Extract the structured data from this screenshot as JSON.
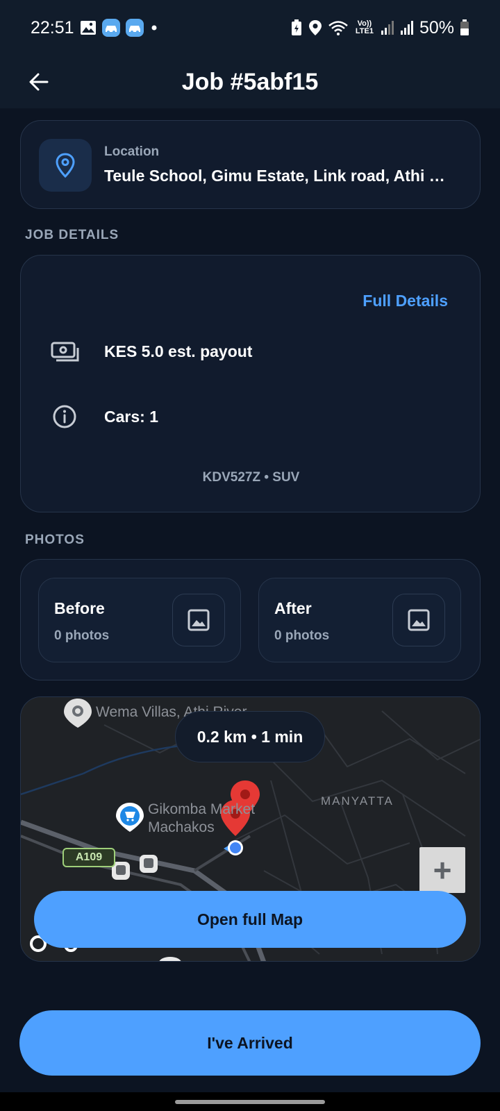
{
  "status_bar": {
    "time": "22:51",
    "battery": "50%",
    "network_label": "Vo)) LTE1",
    "icons": [
      "gallery-icon",
      "car-wash-app-icon",
      "car-wash-app-icon",
      "dot-icon",
      "battery-saver-icon",
      "location-icon",
      "wifi-icon",
      "signal-icon",
      "signal-icon",
      "battery-icon"
    ]
  },
  "appbar": {
    "title": "Job #5abf15",
    "back_icon": "arrow-left-icon"
  },
  "location": {
    "label": "Location",
    "value": "Teule School, Gimu Estate, Link road, Athi …",
    "icon": "map-pin-icon"
  },
  "job_details": {
    "section_label": "JOB DETAILS",
    "full_details_label": "Full Details",
    "payout": "KES 5.0 est. payout",
    "cars": "Cars: 1",
    "vehicle": "KDV527Z • SUV",
    "payout_icon": "money-icon",
    "cars_icon": "info-icon"
  },
  "photos": {
    "section_label": "PHOTOS",
    "tiles": [
      {
        "title": "Before",
        "count": "0 photos",
        "icon": "image-icon"
      },
      {
        "title": "After",
        "count": "0 photos",
        "icon": "image-icon"
      }
    ]
  },
  "map": {
    "eta": "0.2 km • 1 min",
    "place_1": "Wema Villas, Athi River",
    "place_2_line1": "Gikomba Market",
    "place_2_line2": "Machakos",
    "area": "MANYATTA",
    "road": "A109",
    "zoom_in": "+",
    "open_label": "Open full Map"
  },
  "actions": {
    "arrived_label": "I've Arrived"
  },
  "colors": {
    "background": "#0c1422",
    "card": "#111b2d",
    "accent": "#4ea0ff",
    "muted_text": "#9aa7b8",
    "pin_red": "#e53935"
  }
}
